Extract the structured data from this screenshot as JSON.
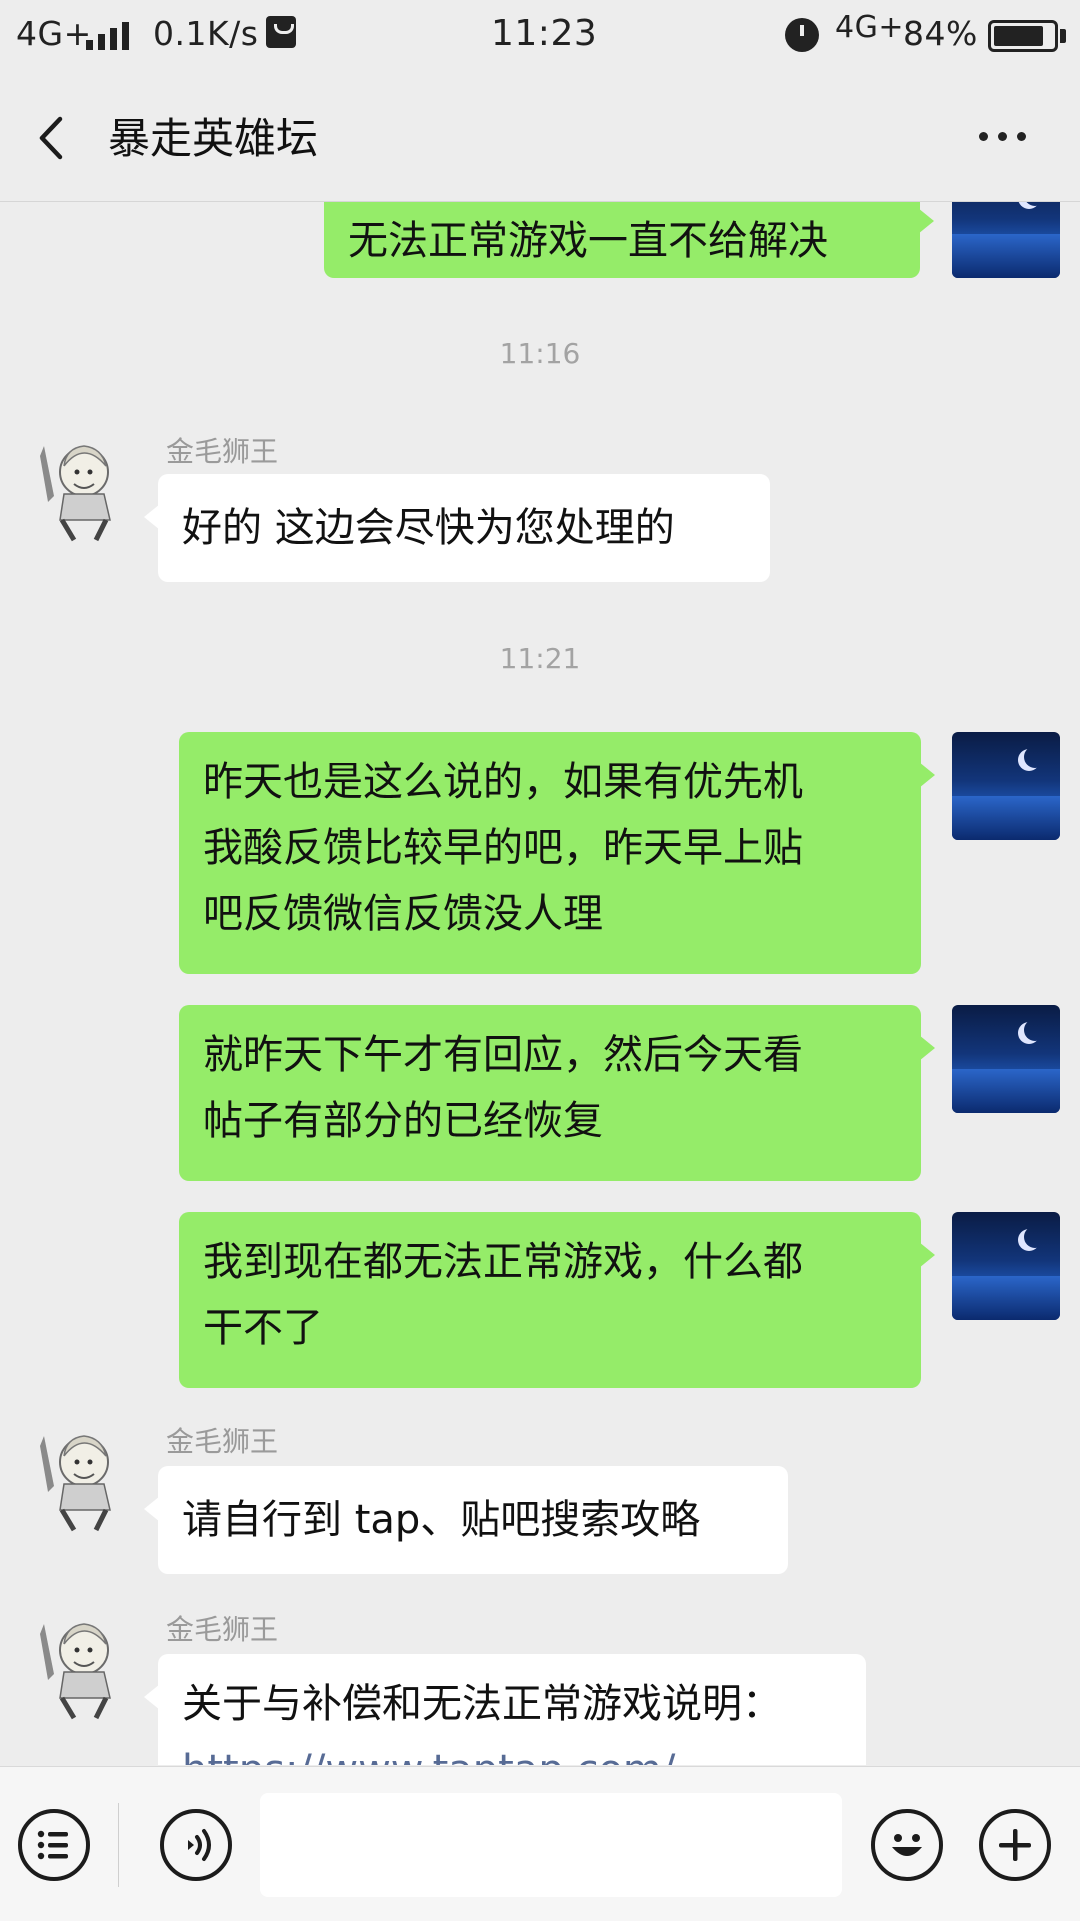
{
  "status_bar": {
    "network": "4G+",
    "speed": "0.1K/s",
    "time": "11:23",
    "network_right": "4G+",
    "battery": "84%",
    "battery_level": 0.84
  },
  "header": {
    "title": "暴走英雄坛",
    "back_icon": "chevron-left-icon",
    "more_icon": "more-dots-icon"
  },
  "chat": {
    "top_partial_message": "无法正常游戏一直不给解决",
    "timestamp_1": "11:16",
    "msg_1": {
      "sender": "金毛狮王",
      "text": "好的 这边会尽快为您处理的"
    },
    "timestamp_2": "11:21",
    "self_msg_1": {
      "lines": [
        "昨天也是这么说的，如果有优先机",
        "我酸反馈比较早的吧，昨天早上贴",
        "吧反馈微信反馈没人理"
      ]
    },
    "self_msg_2": {
      "lines": [
        "就昨天下午才有回应，然后今天看",
        "帖子有部分的已经恢复"
      ]
    },
    "self_msg_3": {
      "lines": [
        "我到现在都无法正常游戏，什么都",
        "干不了"
      ]
    },
    "msg_2": {
      "sender": "金毛狮王",
      "text": "请自行到 tap、贴吧搜索攻略"
    },
    "msg_3": {
      "sender": "金毛狮王",
      "text": "关于与补偿和无法正常游戏说明：",
      "link_partial": "https://www.taptap.com/"
    }
  },
  "input_bar": {
    "list_icon": "list-menu-icon",
    "voice_icon": "voice-icon",
    "emoji_icon": "emoji-icon",
    "plus_icon": "plus-icon",
    "input_value": ""
  },
  "colors": {
    "background": "#ededed",
    "self_bubble": "#95ec69",
    "other_bubble": "#ffffff",
    "link": "#576b95"
  }
}
